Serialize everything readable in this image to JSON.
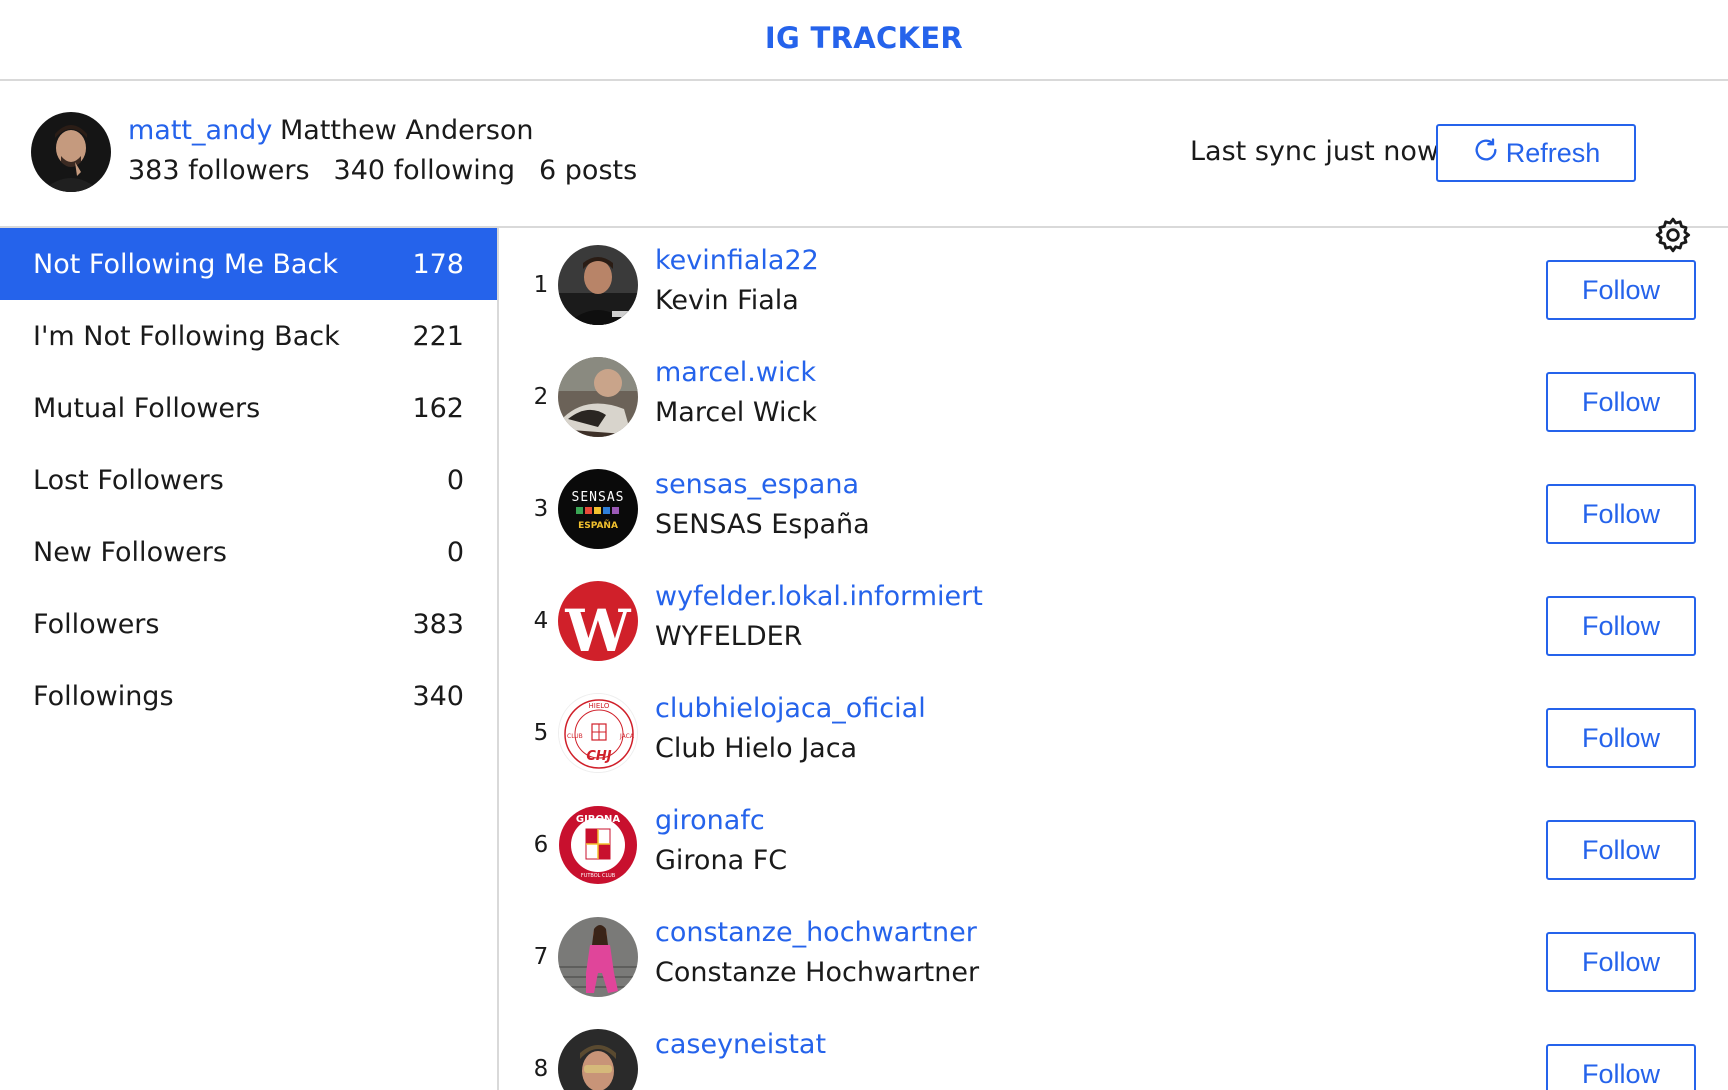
{
  "app": {
    "title": "IG TRACKER"
  },
  "profile": {
    "username": "matt_andy",
    "full_name": "Matthew Anderson",
    "followers": "383 followers",
    "following": "340 following",
    "posts": "6 posts",
    "sync_text": "Last sync just now",
    "refresh_label": "Refresh"
  },
  "sidebar": {
    "items": [
      {
        "label": "Not Following Me Back",
        "count": "178",
        "active": true
      },
      {
        "label": "I'm Not Following Back",
        "count": "221",
        "active": false
      },
      {
        "label": "Mutual Followers",
        "count": "162",
        "active": false
      },
      {
        "label": "Lost Followers",
        "count": "0",
        "active": false
      },
      {
        "label": "New Followers",
        "count": "0",
        "active": false
      },
      {
        "label": "Followers",
        "count": "383",
        "active": false
      },
      {
        "label": "Followings",
        "count": "340",
        "active": false
      }
    ]
  },
  "list": {
    "rows": [
      {
        "rank": "1",
        "username": "kevinfiala22",
        "name": "Kevin Fiala",
        "button": "Follow"
      },
      {
        "rank": "2",
        "username": "marcel.wick",
        "name": "Marcel Wick",
        "button": "Follow"
      },
      {
        "rank": "3",
        "username": "sensas_espana",
        "name": "SENSAS España",
        "button": "Follow"
      },
      {
        "rank": "4",
        "username": "wyfelder.lokal.informiert",
        "name": "WYFELDER",
        "button": "Follow"
      },
      {
        "rank": "5",
        "username": "clubhielojaca_oficial",
        "name": "Club Hielo Jaca",
        "button": "Follow"
      },
      {
        "rank": "6",
        "username": "gironafc",
        "name": "Girona FC",
        "button": "Follow"
      },
      {
        "rank": "7",
        "username": "constanze_hochwartner",
        "name": "Constanze Hochwartner",
        "button": "Follow"
      },
      {
        "rank": "8",
        "username": "caseyneistat",
        "name": "",
        "button": "Follow"
      }
    ]
  },
  "avatar_text": {
    "sensas_line1": "SENSAS",
    "sensas_line2": "ESPAÑA",
    "wyfelder_letter": "W",
    "chj_top": "HIELO",
    "chj_left": "CLUB",
    "chj_right": "JACA",
    "chj_mark": "CHJ",
    "girona_top": "GIRONA",
    "girona_bottom": "FUTBOL CLUB"
  },
  "colors": {
    "accent": "#2563eb",
    "border": "#d9d9d9"
  }
}
